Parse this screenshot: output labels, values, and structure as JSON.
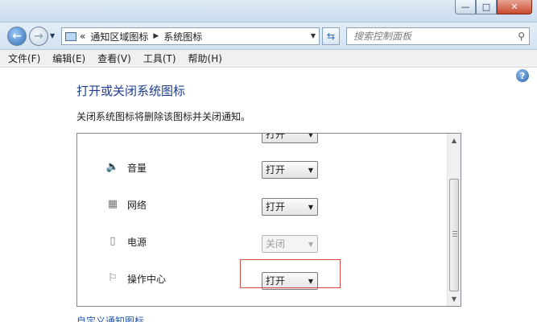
{
  "window": {
    "min": "—",
    "max": "□",
    "close": "✕"
  },
  "address": {
    "crumbs": [
      "«",
      "通知区域图标",
      "系统图标"
    ],
    "search_placeholder": "搜索控制面板"
  },
  "menu": [
    "文件(F)",
    "编辑(E)",
    "查看(V)",
    "工具(T)",
    "帮助(H)"
  ],
  "page": {
    "title": "打开或关闭系统图标",
    "description": "关闭系统图标将删除该图标并关闭通知。",
    "link": "自定义通知图标"
  },
  "rows": [
    {
      "label": "",
      "value": "打开",
      "enabled": true,
      "icon": "clock-icon"
    },
    {
      "label": "音量",
      "value": "打开",
      "enabled": true,
      "icon": "speaker-icon"
    },
    {
      "label": "网络",
      "value": "打开",
      "enabled": true,
      "icon": "network-icon"
    },
    {
      "label": "电源",
      "value": "关闭",
      "enabled": false,
      "icon": "power-icon"
    },
    {
      "label": "操作中心",
      "value": "打开",
      "enabled": true,
      "icon": "flag-icon"
    }
  ],
  "colors": {
    "title_blue": "#1e3c8c",
    "link_blue": "#1e56b0",
    "highlight_red": "#d94b4b"
  }
}
